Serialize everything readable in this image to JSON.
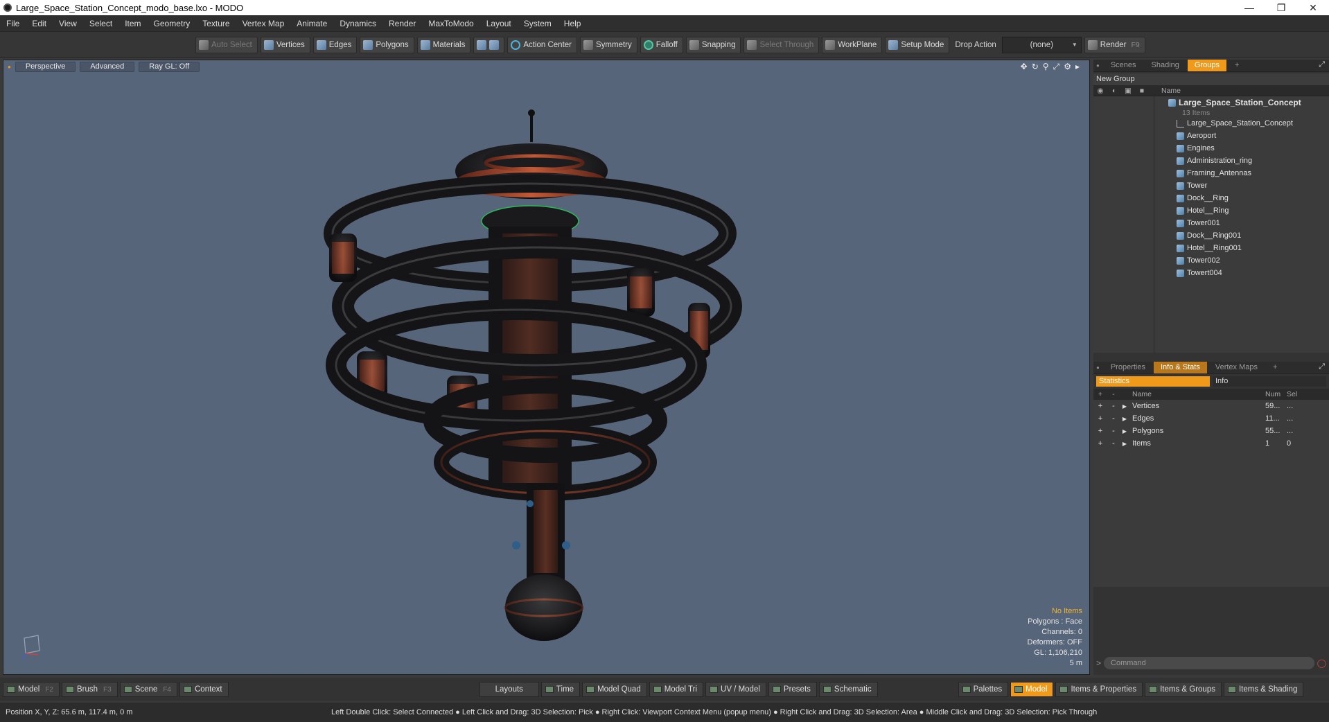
{
  "window": {
    "title": "Large_Space_Station_Concept_modo_base.lxo - MODO"
  },
  "menu": [
    "File",
    "Edit",
    "View",
    "Select",
    "Item",
    "Geometry",
    "Texture",
    "Vertex Map",
    "Animate",
    "Dynamics",
    "Render",
    "MaxToModo",
    "Layout",
    "System",
    "Help"
  ],
  "toolbar": {
    "auto_select": "Auto Select",
    "vertices": "Vertices",
    "edges": "Edges",
    "polygons": "Polygons",
    "materials": "Materials",
    "action_center": "Action Center",
    "symmetry": "Symmetry",
    "falloff": "Falloff",
    "snapping": "Snapping",
    "select_through": "Select Through",
    "workplane": "WorkPlane",
    "setup_mode": "Setup Mode",
    "drop_action": "Drop Action",
    "drop_value": "(none)",
    "render": "Render",
    "render_key": "F9"
  },
  "viewport": {
    "tabs": [
      "Perspective",
      "Advanced",
      "Ray GL: Off"
    ],
    "info": {
      "selection": "No Items",
      "polygons": "Polygons : Face",
      "channels": "Channels: 0",
      "deformers": "Deformers: OFF",
      "gl": "GL: 1,106,210",
      "scale": "5 m"
    }
  },
  "groups_panel": {
    "tabs": [
      "Scenes",
      "Shading",
      "Groups"
    ],
    "new_group": "New Group",
    "name_col": "Name",
    "root": "Large_Space_Station_Concept",
    "root_sub": "13 Items",
    "items": [
      "Large_Space_Station_Concept",
      "Aeroport",
      "Engines",
      "Administration_ring",
      "Framing_Antennas",
      "Tower",
      "Dock__Ring",
      "Hotel__Ring",
      "Tower001",
      "Dock__Ring001",
      "Hotel__Ring001",
      "Tower002",
      "Towert004"
    ]
  },
  "stats_panel": {
    "tabs": [
      "Properties",
      "Info & Stats",
      "Vertex Maps"
    ],
    "subtabs": [
      "Statistics",
      "Info"
    ],
    "cols": {
      "name": "Name",
      "num": "Num",
      "sel": "Sel"
    },
    "rows": [
      {
        "name": "Vertices",
        "num": "59...",
        "sel": "..."
      },
      {
        "name": "Edges",
        "num": "11...",
        "sel": "..."
      },
      {
        "name": "Polygons",
        "num": "55...",
        "sel": "..."
      },
      {
        "name": "Items",
        "num": "1",
        "sel": "0"
      }
    ],
    "command_placeholder": "Command"
  },
  "bottombar": {
    "left": [
      {
        "label": "Model",
        "key": "F2"
      },
      {
        "label": "Brush",
        "key": "F3"
      },
      {
        "label": "Scene",
        "key": "F4"
      },
      {
        "label": "Context",
        "key": ""
      }
    ],
    "center": [
      "Layouts",
      "Time",
      "Model Quad",
      "Model Tri",
      "UV / Model",
      "Presets",
      "Schematic"
    ],
    "right": [
      "Palettes",
      "Model",
      "Items & Properties",
      "Items & Groups",
      "Items & Shading"
    ]
  },
  "status": {
    "position": "Position X, Y, Z:  65.6 m, 117.4 m, 0 m",
    "hint": "Left Double Click: Select Connected ● Left Click and Drag: 3D Selection: Pick ● Right Click: Viewport Context Menu (popup menu) ● Right Click and Drag: 3D Selection: Area ● Middle Click and Drag: 3D Selection: Pick Through"
  }
}
